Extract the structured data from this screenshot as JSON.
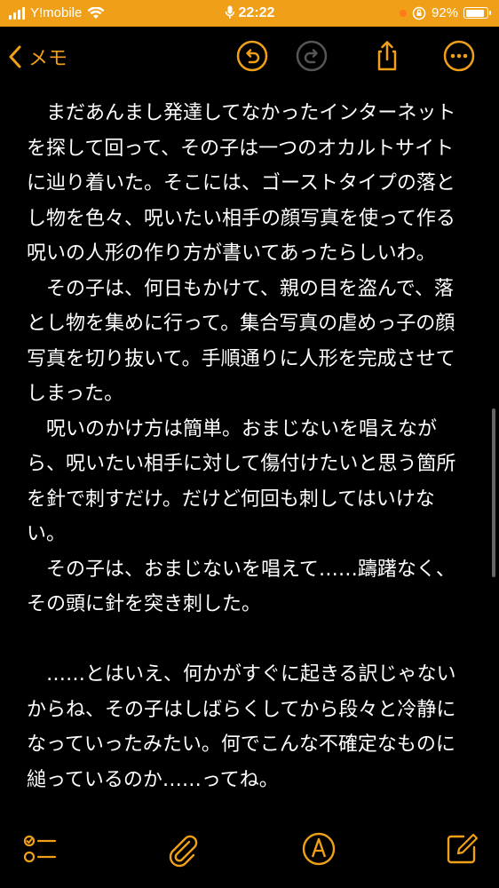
{
  "status_bar": {
    "carrier": "Y!mobile",
    "time": "22:22",
    "battery": "92%",
    "battery_level": 0.92,
    "bg_color": "#f0a018"
  },
  "navbar": {
    "back_label": "メモ",
    "accent": "#f0a018",
    "icons": [
      "undo-icon",
      "redo-icon",
      "share-icon",
      "more-icon"
    ]
  },
  "note": {
    "paragraphs": [
      "　まだあんまし発達してなかったインターネットを探して回って、その子は一つのオカルトサイトに辿り着いた。そこには、ゴーストタイプの落とし物を色々、呪いたい相手の顔写真を使って作る呪いの人形の作り方が書いてあったらしいわ。",
      "　その子は、何日もかけて、親の目を盗んで、落とし物を集めに行って。集合写真の虐めっ子の顔写真を切り抜いて。手順通りに人形を完成させてしまった。",
      "　呪いのかけ方は簡単。おまじないを唱えながら、呪いたい相手に対して傷付けたいと思う箇所を針で刺すだけ。だけど何回も刺してはいけない。",
      "　その子は、おまじないを唱えて……躊躇なく、その頭に針を突き刺した。",
      "",
      "　……とはいえ、何かがすぐに起きる訳じゃないからね、その子はしばらくしてから段々と冷静になっていったみたい。何でこんな不確定なものに縋っているのか……ってね。"
    ]
  },
  "toolbar": {
    "icons": [
      "checklist-icon",
      "attachment-icon",
      "markup-icon",
      "compose-icon"
    ]
  }
}
